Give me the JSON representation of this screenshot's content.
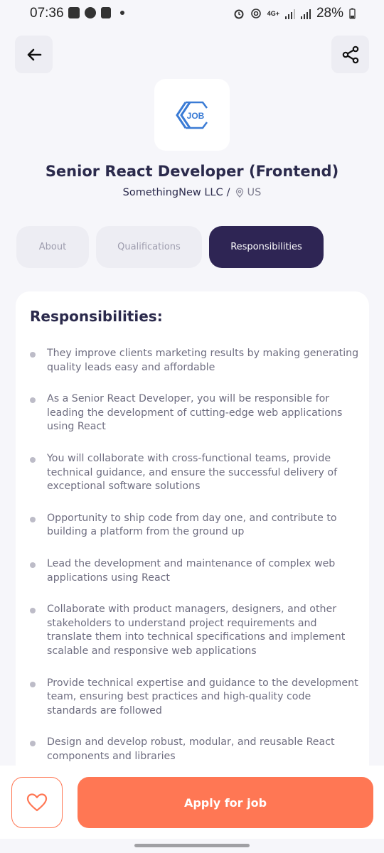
{
  "status_bar": {
    "time": "07:36",
    "network": "4G+",
    "battery": "28%"
  },
  "header": {
    "back_icon": "arrow-left-icon",
    "share_icon": "share-icon"
  },
  "logo": {
    "text": "JOB"
  },
  "job": {
    "title": "Senior React Developer (Frontend)",
    "company": "SomethingNew LLC",
    "separator": "/",
    "location": "US"
  },
  "tabs": [
    {
      "label": "About",
      "active": false
    },
    {
      "label": "Qualifications",
      "active": false
    },
    {
      "label": "Responsibilities",
      "active": true
    }
  ],
  "section": {
    "title": "Responsibilities:",
    "items": [
      "They improve clients marketing results by making generating quality leads easy and affordable",
      "As a Senior React Developer, you will be responsible for leading the development of cutting-edge web applications using React",
      "You will collaborate with cross-functional teams, provide technical guidance, and ensure the successful delivery of exceptional software solutions",
      "Opportunity to ship code from day one, and contribute to building a platform from the ground up",
      "Lead the development and maintenance of complex web applications using React",
      "Collaborate with product managers, designers, and other stakeholders to understand project requirements and translate them into technical specifications and implement scalable and responsive web applications",
      "Provide technical expertise and guidance to the development team, ensuring best practices and high-quality code standards are followed",
      "Design and develop robust, modular, and reusable React components and libraries"
    ]
  },
  "footer": {
    "apply_label": "Apply for job",
    "favorite_icon": "heart-icon"
  },
  "colors": {
    "primary_dark": "#2E2554",
    "accent": "#FF7754",
    "background": "#F6F6FA",
    "logo_blue": "#3A7BD5"
  }
}
